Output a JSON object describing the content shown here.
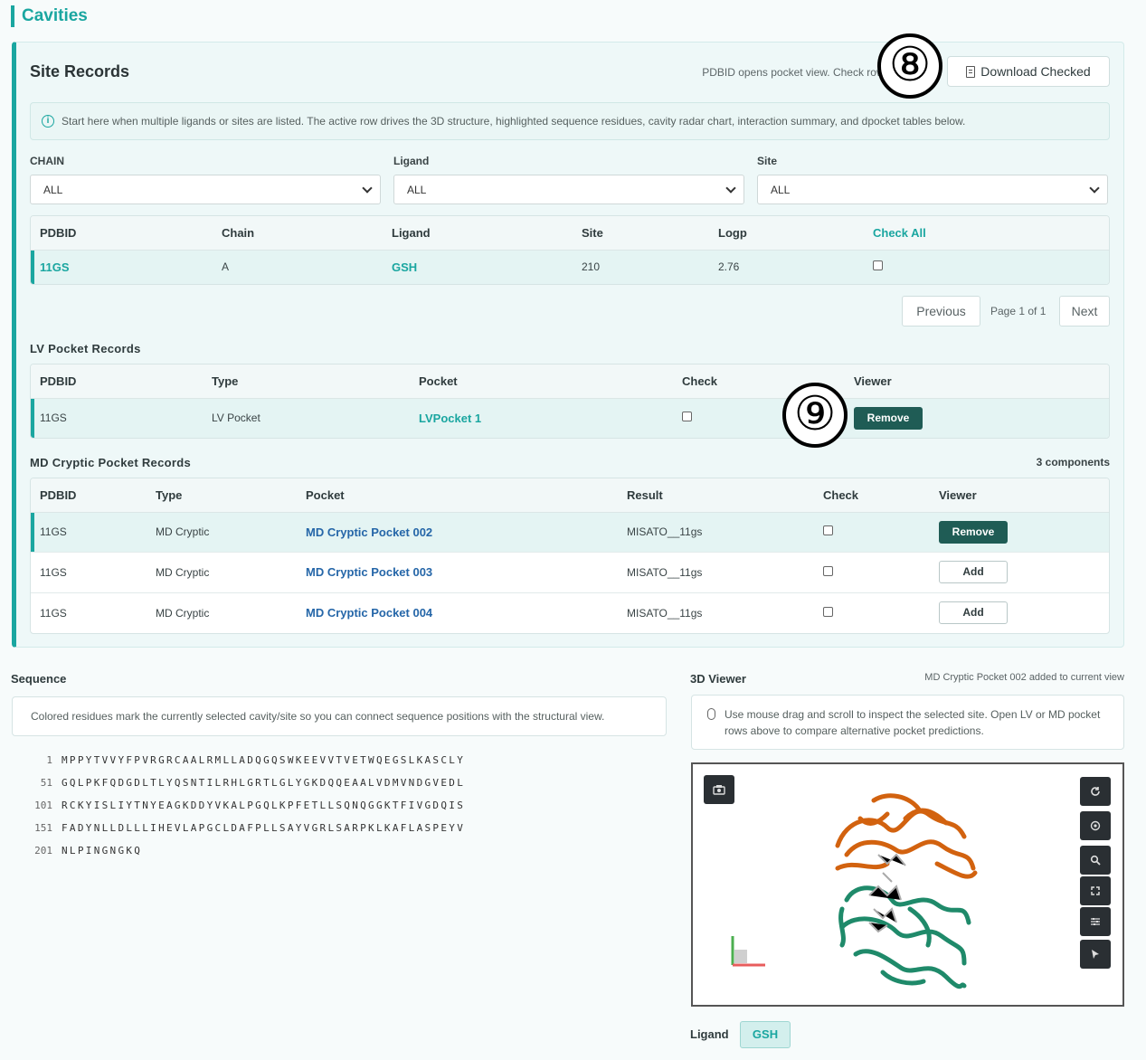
{
  "page_title": "Cavities",
  "site_records": {
    "title": "Site Records",
    "top_hint": "PDBID opens pocket view. Check rows to export.",
    "download_label": "Download Checked",
    "info": "Start here when multiple ligands or sites are listed. The active row drives the 3D structure, highlighted sequence residues, cavity radar chart, interaction summary, and dpocket tables below.",
    "filters": [
      {
        "label": "CHAIN",
        "value": "ALL"
      },
      {
        "label": "Ligand",
        "value": "ALL"
      },
      {
        "label": "Site",
        "value": "ALL"
      }
    ],
    "headers": [
      "PDBID",
      "Chain",
      "Ligand",
      "Site",
      "Logp",
      "Check All"
    ],
    "rows": [
      {
        "pdbid": "11GS",
        "chain": "A",
        "ligand": "GSH",
        "site": "210",
        "logp": "2.76"
      }
    ],
    "pager": {
      "prev": "Previous",
      "page": "Page 1 of 1",
      "next": "Next"
    }
  },
  "annotations": {
    "eight": "⑧",
    "nine": "⑨"
  },
  "lv_pocket": {
    "title": "LV Pocket Records",
    "headers": [
      "PDBID",
      "Type",
      "Pocket",
      "Check",
      "Viewer"
    ],
    "rows": [
      {
        "pdbid": "11GS",
        "type": "LV Pocket",
        "pocket": "LVPocket 1",
        "action": "Remove"
      }
    ]
  },
  "md_pocket": {
    "title": "MD Cryptic Pocket Records",
    "components": "3 components",
    "headers": [
      "PDBID",
      "Type",
      "Pocket",
      "Result",
      "Check",
      "Viewer"
    ],
    "rows": [
      {
        "pdbid": "11GS",
        "type": "MD Cryptic",
        "pocket": "MD Cryptic Pocket 002",
        "result": "MISATO__11gs",
        "action": "Remove"
      },
      {
        "pdbid": "11GS",
        "type": "MD Cryptic",
        "pocket": "MD Cryptic Pocket 003",
        "result": "MISATO__11gs",
        "action": "Add"
      },
      {
        "pdbid": "11GS",
        "type": "MD Cryptic",
        "pocket": "MD Cryptic Pocket 004",
        "result": "MISATO__11gs",
        "action": "Add"
      }
    ]
  },
  "sequence": {
    "title": "Sequence",
    "hint": "Colored residues mark the currently selected cavity/site so you can connect sequence positions with the structural view.",
    "lines": [
      {
        "num": "1",
        "res": "MPPYTVVYFPVRGRCAALRMLLADQGQSWKEEVVTVETWQEGSLKASCLY"
      },
      {
        "num": "51",
        "res": "GQLPKFQDGDLTLYQSNTILRHLGRTLGLYGKDQQEAALVDMVNDGVEDL"
      },
      {
        "num": "101",
        "res": "RCKYISLIYTNYEAGKDDYVKALPGQLKPFETLLSQNQGGKTFIVGDQIS"
      },
      {
        "num": "151",
        "res": "FADYNLLDLLLIHEVLAPGCLDAFPLLSAYVGRLSARPKLKAFLASPEYV"
      },
      {
        "num": "201",
        "res": "NLPINGNGKQ"
      }
    ]
  },
  "viewer": {
    "title": "3D Viewer",
    "status": "MD Cryptic Pocket 002 added to current view",
    "hint": "Use mouse drag and scroll to inspect the selected site. Open LV or MD pocket rows above to compare alternative pocket predictions.",
    "tools": [
      "reset-icon",
      "spin-icon",
      "zoom-icon",
      "fullscreen-icon",
      "settings-icon",
      "select-icon"
    ],
    "colors": {
      "chain_a": "#d2620f",
      "chain_b": "#1f8a6a",
      "ligand": "#aaaaaa"
    }
  },
  "ligand": {
    "label": "Ligand",
    "chip": "GSH"
  }
}
